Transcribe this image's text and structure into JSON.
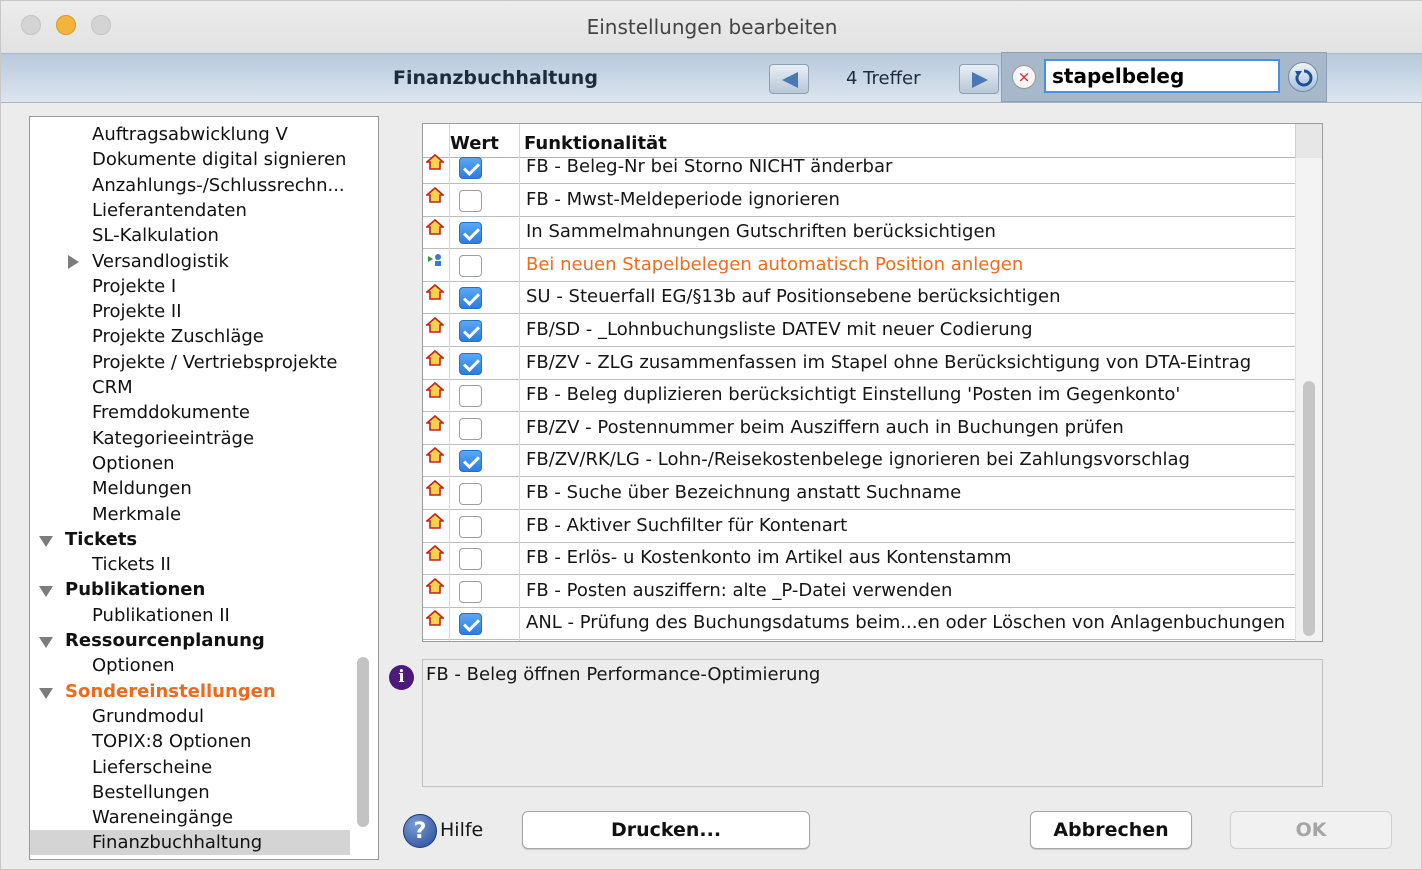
{
  "window": {
    "title": "Einstellungen bearbeiten"
  },
  "toolbar": {
    "section_title": "Finanzbuchhaltung",
    "hits": "4 Treffer",
    "search_value": "stapelbeleg",
    "clear_glyph": "×"
  },
  "sidebar": {
    "items": [
      {
        "label": "Auftragsabwicklung V",
        "level": "child"
      },
      {
        "label": "Dokumente digital signieren",
        "level": "child"
      },
      {
        "label": "Anzahlungs-/Schlussrechn...",
        "level": "child"
      },
      {
        "label": "Lieferantendaten",
        "level": "child"
      },
      {
        "label": "SL-Kalkulation",
        "level": "child"
      },
      {
        "label": "Versandlogistik",
        "level": "child",
        "collapsed": true
      },
      {
        "label": "Projekte I",
        "level": "child"
      },
      {
        "label": "Projekte II",
        "level": "child"
      },
      {
        "label": "Projekte Zuschläge",
        "level": "child"
      },
      {
        "label": "Projekte / Vertriebsprojekte",
        "level": "child"
      },
      {
        "label": "CRM",
        "level": "child"
      },
      {
        "label": "Fremddokumente",
        "level": "child"
      },
      {
        "label": "Kategorieeinträge",
        "level": "child"
      },
      {
        "label": "Optionen",
        "level": "child"
      },
      {
        "label": "Meldungen",
        "level": "child"
      },
      {
        "label": "Merkmale",
        "level": "child"
      },
      {
        "label": "Tickets",
        "level": "parent"
      },
      {
        "label": "Tickets II",
        "level": "child"
      },
      {
        "label": "Publikationen",
        "level": "parent"
      },
      {
        "label": "Publikationen II",
        "level": "child"
      },
      {
        "label": "Ressourcenplanung",
        "level": "parent"
      },
      {
        "label": "Optionen",
        "level": "child"
      },
      {
        "label": "Sondereinstellungen",
        "level": "parent",
        "highlight": true
      },
      {
        "label": "Grundmodul",
        "level": "child"
      },
      {
        "label": "TOPIX:8 Optionen",
        "level": "child"
      },
      {
        "label": "Lieferscheine",
        "level": "child"
      },
      {
        "label": "Bestellungen",
        "level": "child"
      },
      {
        "label": "Wareneingänge",
        "level": "child"
      },
      {
        "label": "Finanzbuchhaltung",
        "level": "child",
        "selected": true
      }
    ]
  },
  "grid": {
    "columns": [
      "Wert",
      "Funktionalität"
    ],
    "rows": [
      {
        "icon": "house-icon",
        "checked": true,
        "label": "FB - Beleg-Nr bei Storno NICHT änderbar"
      },
      {
        "icon": "house-icon",
        "checked": false,
        "label": "FB - Mwst-Meldeperiode ignorieren"
      },
      {
        "icon": "house-icon",
        "checked": true,
        "label": "In Sammelmahnungen Gutschriften berücksichtigen"
      },
      {
        "icon": "user-flag-icon",
        "checked": false,
        "label": "Bei neuen Stapelbelegen automatisch Position anlegen",
        "highlight": true
      },
      {
        "icon": "house-icon",
        "checked": true,
        "label": "SU - Steuerfall EG/§13b auf Positionsebene berücksichtigen"
      },
      {
        "icon": "house-icon",
        "checked": true,
        "label": "FB/SD - _Lohnbuchungsliste DATEV mit neuer Codierung"
      },
      {
        "icon": "house-icon",
        "checked": true,
        "label": "FB/ZV - ZLG zusammenfassen im Stapel ohne Berücksichtigung von DTA-Eintrag"
      },
      {
        "icon": "house-icon",
        "checked": false,
        "label": "FB - Beleg duplizieren berücksichtigt Einstellung 'Posten im Gegenkonto'"
      },
      {
        "icon": "house-icon",
        "checked": false,
        "label": "FB/ZV - Postennummer beim Ausziffern auch in Buchungen prüfen"
      },
      {
        "icon": "house-icon",
        "checked": true,
        "label": "FB/ZV/RK/LG - Lohn-/Reisekostenbelege ignorieren bei Zahlungsvorschlag"
      },
      {
        "icon": "house-icon",
        "checked": false,
        "label": "FB - Suche über Bezeichnung anstatt Suchname"
      },
      {
        "icon": "house-icon",
        "checked": false,
        "label": "FB - Aktiver Suchfilter für Kontenart"
      },
      {
        "icon": "house-icon",
        "checked": false,
        "label": "FB - Erlös- u Kostenkonto im Artikel aus Kontenstamm"
      },
      {
        "icon": "house-icon",
        "checked": false,
        "label": "FB - Posten ausziffern: alte _P-Datei verwenden"
      },
      {
        "icon": "house-icon",
        "checked": true,
        "label": "ANL - Prüfung des Buchungsdatums beim...en oder Löschen von Anlagenbuchungen"
      }
    ]
  },
  "info": {
    "glyph": "i",
    "text": "FB - Beleg öffnen Performance-Optimierung"
  },
  "footer": {
    "help_glyph": "?",
    "help_label": "Hilfe",
    "print_label": "Drucken...",
    "cancel_label": "Abbrechen",
    "ok_label": "OK"
  }
}
